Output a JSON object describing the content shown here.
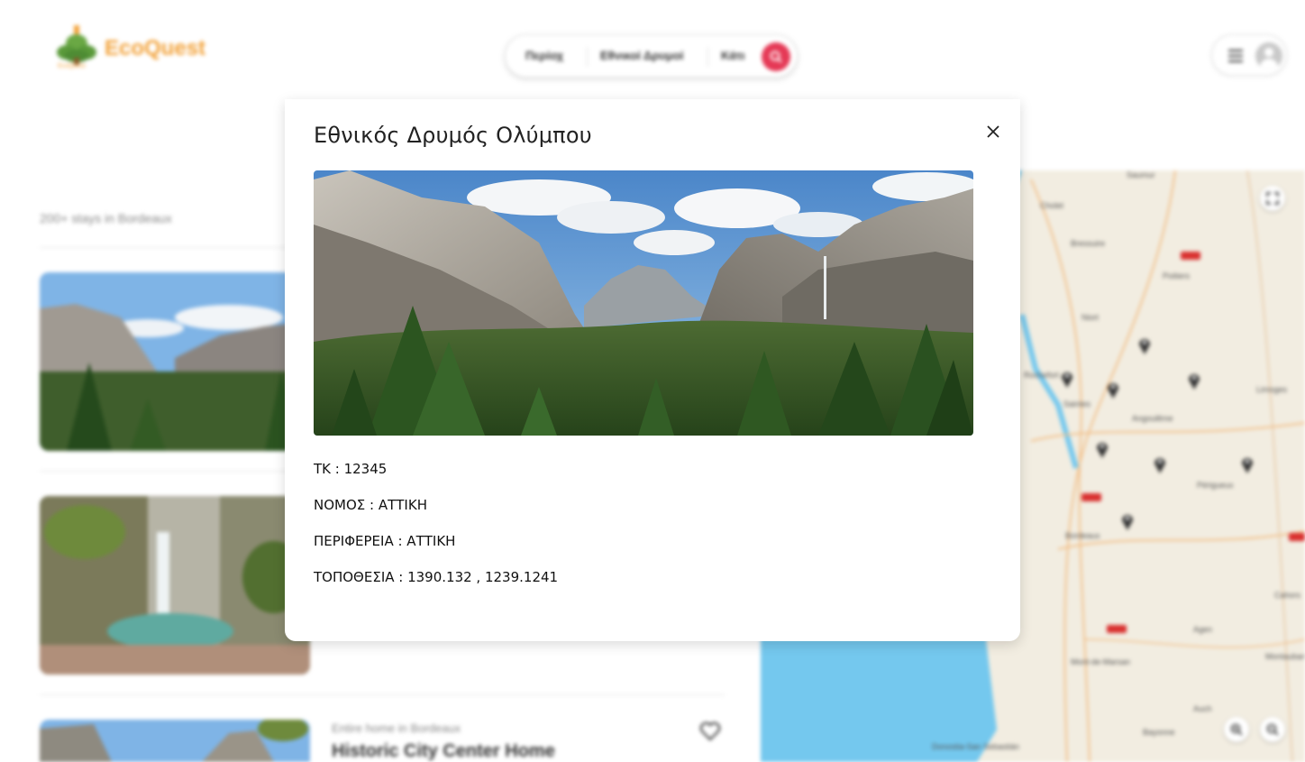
{
  "header": {
    "logo_text": "EcoQuest",
    "logo_subtext": "EcoQuest",
    "nav_items": [
      "Περίοχ",
      "Εθνικοί Δρυμοί",
      "Κάτι"
    ],
    "search_button_icon": "search-icon",
    "menu_icon": "hamburger-icon",
    "avatar_icon": "user-avatar-icon"
  },
  "listings": {
    "stays_label": "200+ stays in Bordeaux",
    "items": [
      {
        "image": "valley-mountains"
      },
      {
        "image": "waterfall-pool"
      },
      {
        "image": "rocky-cliff",
        "meta": "Entire home in Bordeaux",
        "title": "Historic City Center Home",
        "favorite_icon": "heart-icon"
      }
    ]
  },
  "map": {
    "labels": [
      "Saumur",
      "Cholet",
      "Bressuire",
      "Poitiers",
      "Niort",
      "Rochefort",
      "Saintes",
      "Angoulême",
      "Limoges",
      "Périgueux",
      "Bordeaux",
      "Agen",
      "Mont-de-Marsan",
      "Cahors",
      "Montauban",
      "Auch",
      "Bayonne",
      "Donostia-San Sebastián"
    ],
    "road_badges": [
      "A10",
      "A10",
      "A62",
      "A89"
    ],
    "pin_count": 9,
    "fullscreen_icon": "fullscreen-icon",
    "zoom_in_icon": "zoom-in-icon",
    "zoom_out_icon": "zoom-out-icon",
    "colors": {
      "land": "#f2ede1",
      "sea": "#74c8ee",
      "road": "#f2c08a",
      "pin": "#333333"
    }
  },
  "modal": {
    "title": "Εθνικός Δρυμός Ολύμπου",
    "close_icon": "close-icon",
    "image": "yosemite-valley-panorama",
    "details": [
      "ΤΚ : 12345",
      "ΝΟΜΟΣ : ΑΤΤΙΚΗ",
      "ΠΕΡΙΦΕΡΕΙΑ : ΑΤΤΙΚΗ",
      "ΤΟΠΟΘΕΣΙΑ : 1390.132 , 1239.1241"
    ]
  },
  "colors": {
    "accent": "#e53956",
    "brand": "#f2a23a"
  }
}
